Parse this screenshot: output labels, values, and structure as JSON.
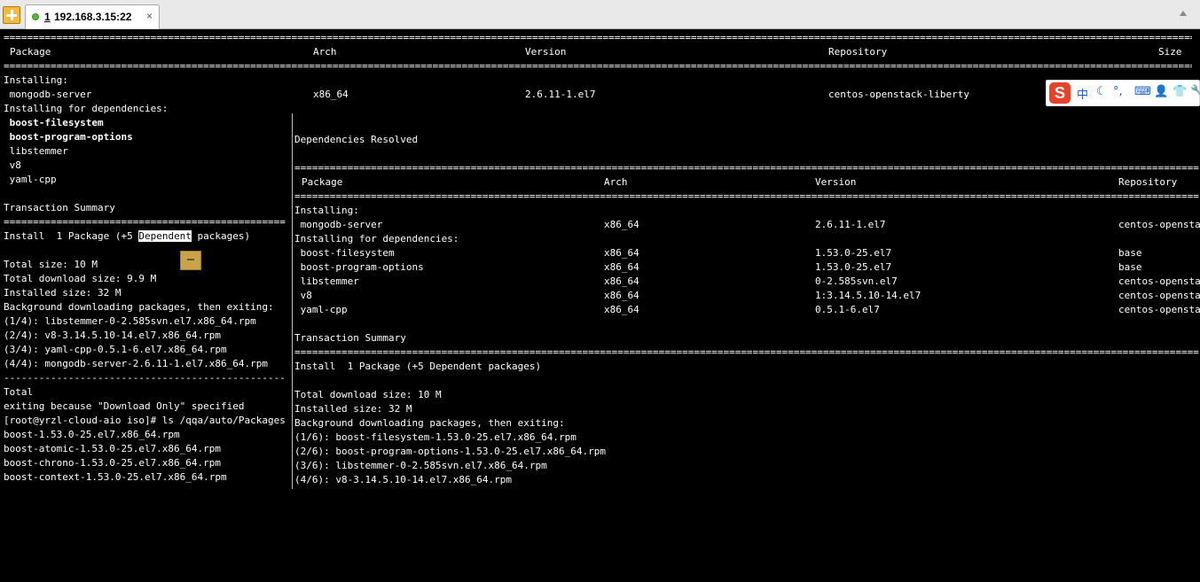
{
  "tabbar": {
    "tab": {
      "number": "1",
      "title": "192.168.3.15:22",
      "close": "×"
    }
  },
  "terminal_main": {
    "rule_double": "======================================================================================================================================================================================================================",
    "header": {
      "package": "Package",
      "arch": "Arch",
      "version": "Version",
      "repository": "Repository",
      "size": "Size"
    },
    "installing": "Installing:",
    "main_pkg": {
      "name": " mongodb-server",
      "arch": "x86_64",
      "version": "2.6.11-1.el7",
      "repo": "centos-openstack-liberty"
    },
    "deps_label": "Installing for dependencies:",
    "left_lines": [
      " boost-filesystem",
      " boost-program-options",
      " libstemmer",
      " v8",
      " yaml-cpp",
      "",
      "Transaction Summary",
      "================================================",
      "Install  1 Package (+5 ",
      "",
      "Total size: 10 M",
      "Total download size: 9.9 M",
      "Installed size: 32 M",
      "Background downloading packages, then exiting:",
      "(1/4): libstemmer-0-2.585svn.el7.x86_64.rpm",
      "(2/4): v8-3.14.5.10-14.el7.x86_64.rpm",
      "(3/4): yaml-cpp-0.5.1-6.el7.x86_64.rpm",
      "(4/4): mongodb-server-2.6.11-1.el7.x86_64.rpm",
      "------------------------------------------------",
      "Total",
      "exiting because \"Download Only\" specified",
      "[root@yrzl-cloud-aio iso]# ls /qqa/auto/Packages",
      "boost-1.53.0-25.el7.x86_64.rpm",
      "boost-atomic-1.53.0-25.el7.x86_64.rpm",
      "boost-chrono-1.53.0-25.el7.x86_64.rpm",
      "boost-context-1.53.0-25.el7.x86_64.rpm"
    ],
    "install_highlight": "Dependent",
    "install_tail": " packages)"
  },
  "terminal_overlay": {
    "partial_top": "    · ·      ·",
    "resolved": "Dependencies Resolved",
    "rule_double": "===================================================================================================================================================================",
    "header": {
      "package": "Package",
      "arch": "Arch",
      "version": "Version",
      "repository": "Repository"
    },
    "installing": "Installing:",
    "deps_label": "Installing for dependencies:",
    "rows": [
      {
        "name": " mongodb-server",
        "arch": "x86_64",
        "version": "2.6.11-1.el7",
        "repo": "centos-openstac"
      },
      {
        "name": " boost-filesystem",
        "arch": "x86_64",
        "version": "1.53.0-25.el7",
        "repo": "base"
      },
      {
        "name": " boost-program-options",
        "arch": "x86_64",
        "version": "1.53.0-25.el7",
        "repo": "base"
      },
      {
        "name": " libstemmer",
        "arch": "x86_64",
        "version": "0-2.585svn.el7",
        "repo": "centos-openstac"
      },
      {
        "name": " v8",
        "arch": "x86_64",
        "version": "1:3.14.5.10-14.el7",
        "repo": "centos-openstac"
      },
      {
        "name": " yaml-cpp",
        "arch": "x86_64",
        "version": "0.5.1-6.el7",
        "repo": "centos-openstac"
      }
    ],
    "summary": "Transaction Summary",
    "install": "Install  1 Package (+5 Dependent packages)",
    "lines": [
      "Total download size: 10 M",
      "Installed size: 32 M",
      "Background downloading packages, then exiting:",
      "(1/6): boost-filesystem-1.53.0-25.el7.x86_64.rpm",
      "(2/6): boost-program-options-1.53.0-25.el7.x86_64.rpm",
      "(3/6): libstemmer-0-2.585svn.el7.x86_64.rpm",
      "(4/6): v8-3.14.5.10-14.el7.x86_64.rpm"
    ]
  },
  "ime_toolbar": {
    "logo": "S",
    "items": [
      "中",
      "☾",
      "°,",
      "⌨",
      "👤",
      "👕",
      "🔧"
    ]
  },
  "colors": {
    "terminal_bg": "#000000",
    "terminal_fg": "#ffffff",
    "tab_dot": "#56b93a",
    "ime_logo": "#e8432a"
  }
}
